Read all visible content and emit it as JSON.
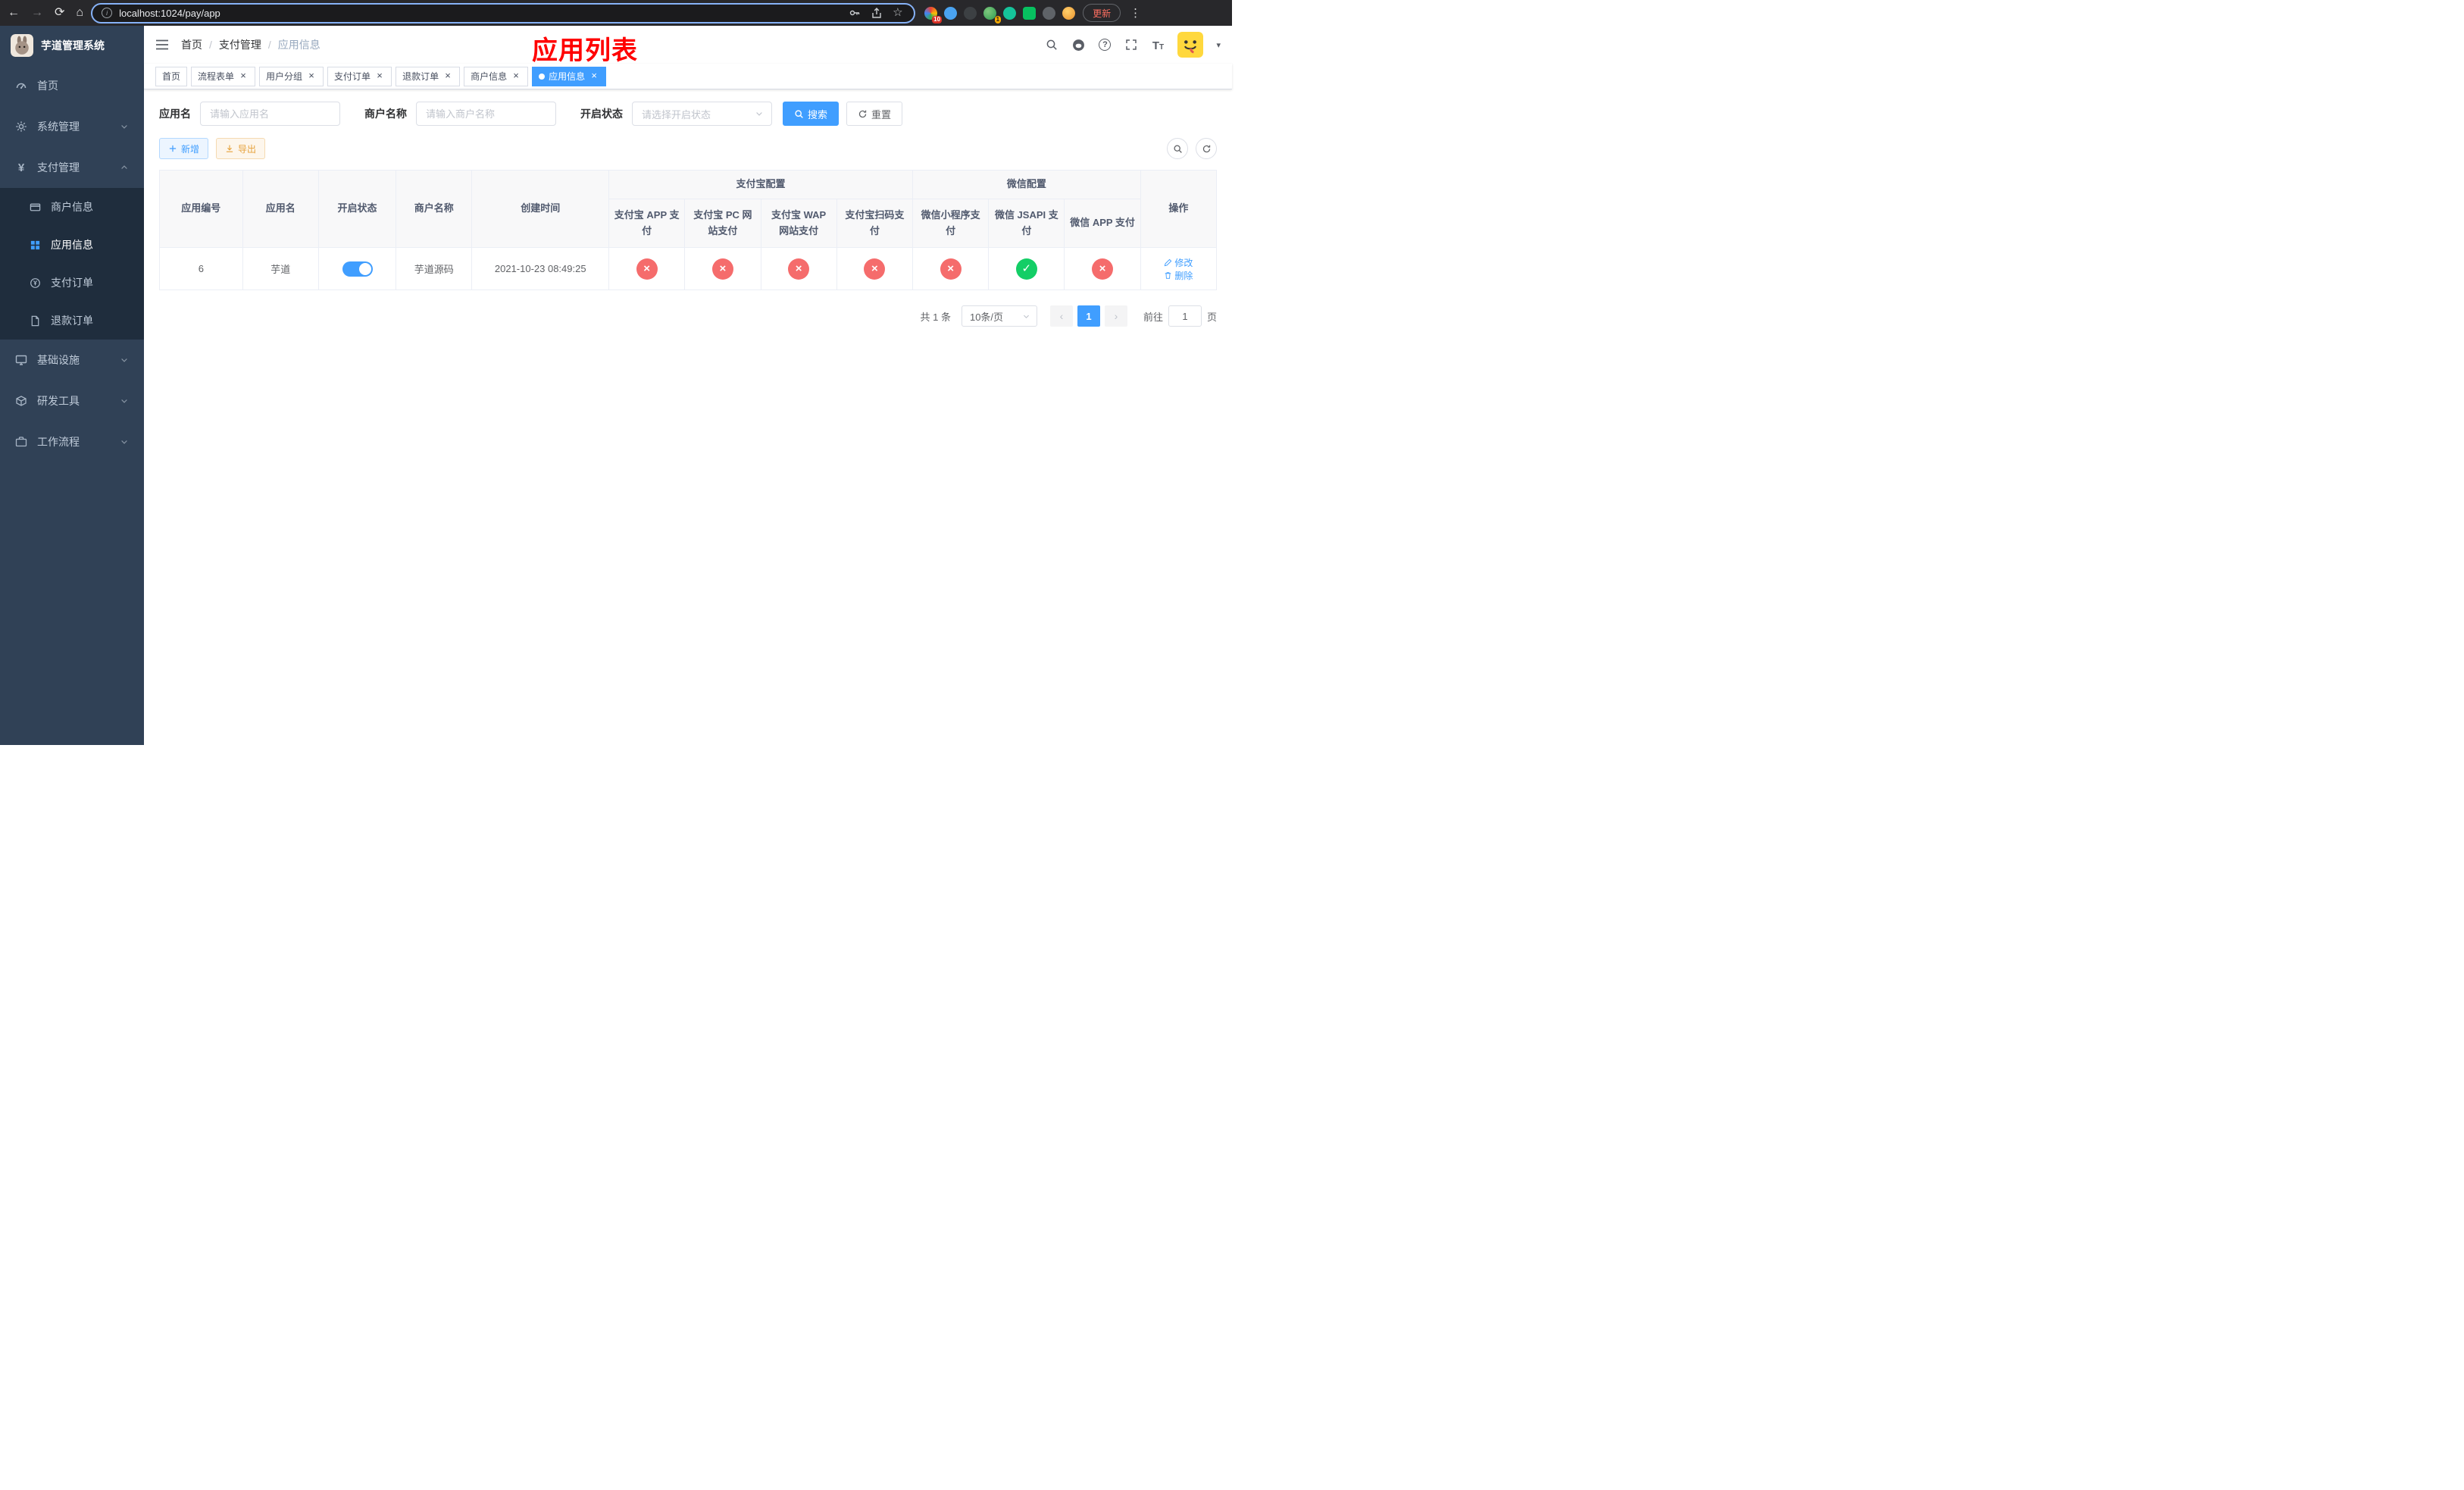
{
  "browser": {
    "url": "localhost:1024/pay/app",
    "update_button": "更新",
    "badges": {
      "extensions": "10",
      "green_ext": "1"
    }
  },
  "sidebar": {
    "logo_title": "芋道管理系统",
    "items": [
      {
        "label": "首页"
      },
      {
        "label": "系统管理"
      },
      {
        "label": "支付管理"
      },
      {
        "label": "基础设施"
      },
      {
        "label": "研发工具"
      },
      {
        "label": "工作流程"
      }
    ],
    "pay_children": [
      {
        "label": "商户信息"
      },
      {
        "label": "应用信息"
      },
      {
        "label": "支付订单"
      },
      {
        "label": "退款订单"
      }
    ]
  },
  "navbar": {
    "breadcrumb": [
      "首页",
      "支付管理",
      "应用信息"
    ],
    "overlay_title": "应用列表"
  },
  "tabs": [
    {
      "label": "首页"
    },
    {
      "label": "流程表单"
    },
    {
      "label": "用户分组"
    },
    {
      "label": "支付订单"
    },
    {
      "label": "退款订单"
    },
    {
      "label": "商户信息"
    },
    {
      "label": "应用信息"
    }
  ],
  "filters": {
    "app_name_label": "应用名",
    "app_name_placeholder": "请输入应用名",
    "merchant_label": "商户名称",
    "merchant_placeholder": "请输入商户名称",
    "status_label": "开启状态",
    "status_placeholder": "请选择开启状态",
    "search_button": "搜索",
    "reset_button": "重置"
  },
  "toolbar": {
    "add_button": "新增",
    "export_button": "导出"
  },
  "table": {
    "columns": {
      "app_id": "应用编号",
      "app_name": "应用名",
      "status": "开启状态",
      "merchant": "商户名称",
      "created": "创建时间",
      "actions": "操作"
    },
    "groups": {
      "alipay": "支付宝配置",
      "wechat": "微信配置"
    },
    "config_columns": [
      "支付宝 APP 支付",
      "支付宝 PC 网站支付",
      "支付宝 WAP 网站支付",
      "支付宝扫码支付",
      "微信小程序支付",
      "微信 JSAPI 支付",
      "微信 APP 支付"
    ],
    "row": {
      "app_id": "6",
      "app_name": "芋道",
      "status_on": true,
      "merchant": "芋道源码",
      "created": "2021-10-23 08:49:25",
      "configs": [
        false,
        false,
        false,
        false,
        false,
        true,
        false
      ],
      "edit": "修改",
      "delete": "删除"
    }
  },
  "pagination": {
    "total": "共 1 条",
    "page_size": "10条/页",
    "current_page": "1",
    "goto_label": "前往",
    "goto_value": "1",
    "goto_unit": "页"
  },
  "colors": {
    "primary": "#409eff",
    "danger": "#f56c6c",
    "success": "#13ce66",
    "sidebar_bg": "#304156",
    "overlay_title": "#ff0000"
  }
}
